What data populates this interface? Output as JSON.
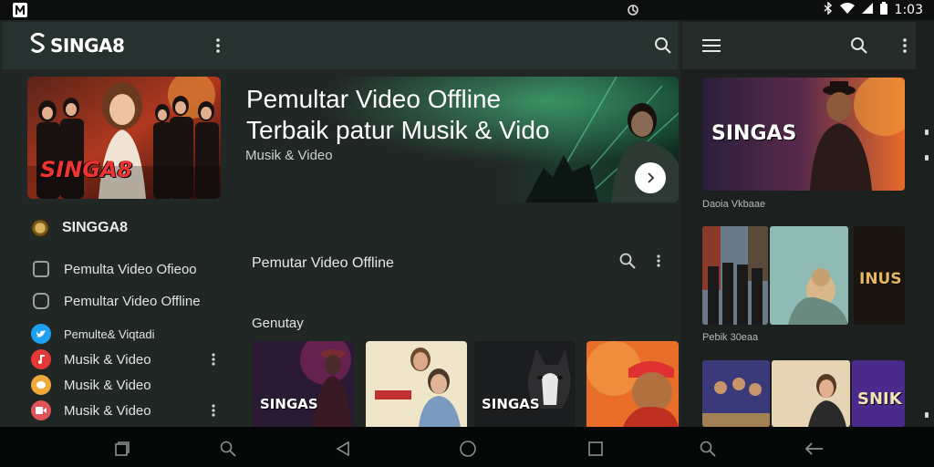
{
  "status_bar": {
    "time": "1:03"
  },
  "app_bar": {
    "logo_text": "SINGA8"
  },
  "featured": {
    "thumb_text": "SINGA8"
  },
  "hero": {
    "title": "Pemultar Video Offline\nTerbaik patur Musik & Vido",
    "subtitle": "Musik & Video"
  },
  "sidebar": {
    "brand": "SINGGA8",
    "items": [
      {
        "label": "Pemulta Video Ofieoo",
        "icon": "document-icon",
        "color": "#8e9592"
      },
      {
        "label": "Pemultar Video Offline",
        "icon": "camera-icon",
        "color": "#8e9592"
      },
      {
        "label": "Pemulte& Viqtadi",
        "icon": "twitter-icon",
        "color": "#1da1f2"
      },
      {
        "label": "Musik & Video",
        "icon": "music-icon",
        "color": "#e53935"
      },
      {
        "label": "Musik & Video",
        "icon": "chat-icon",
        "color": "#f0a83a"
      },
      {
        "label": "Musik & Video",
        "icon": "video-icon",
        "color": "#e0535b"
      }
    ]
  },
  "section": {
    "title": "Pemutar Video Offline",
    "subtitle": "Genutay",
    "cards": [
      {
        "label": "SINGAS",
        "color": "#3a1f3f"
      },
      {
        "label": "",
        "color": "#d9c8a0"
      },
      {
        "label": "SINGAS",
        "color": "#242629"
      },
      {
        "label": "",
        "color": "#e0662a"
      }
    ]
  },
  "right_panel": {
    "thumb_text": "SINGAS",
    "label_1": "Daoia Vkbaae",
    "label_2": "Pebik 30eaa",
    "row1": [
      {
        "label": "",
        "color": "#5b6b7a"
      },
      {
        "label": "",
        "color": "#8fb3b0"
      },
      {
        "label": "INUS",
        "color": "#201a12"
      }
    ],
    "row2": [
      {
        "label": "",
        "color": "#3d3a7a"
      },
      {
        "label": "",
        "color": "#d9c7a5"
      },
      {
        "label": "SNIK",
        "color": "#4a2a8a"
      }
    ]
  },
  "colors": {
    "app_bar": "#263230",
    "background": "#212725",
    "accent_red": "#e33333"
  }
}
